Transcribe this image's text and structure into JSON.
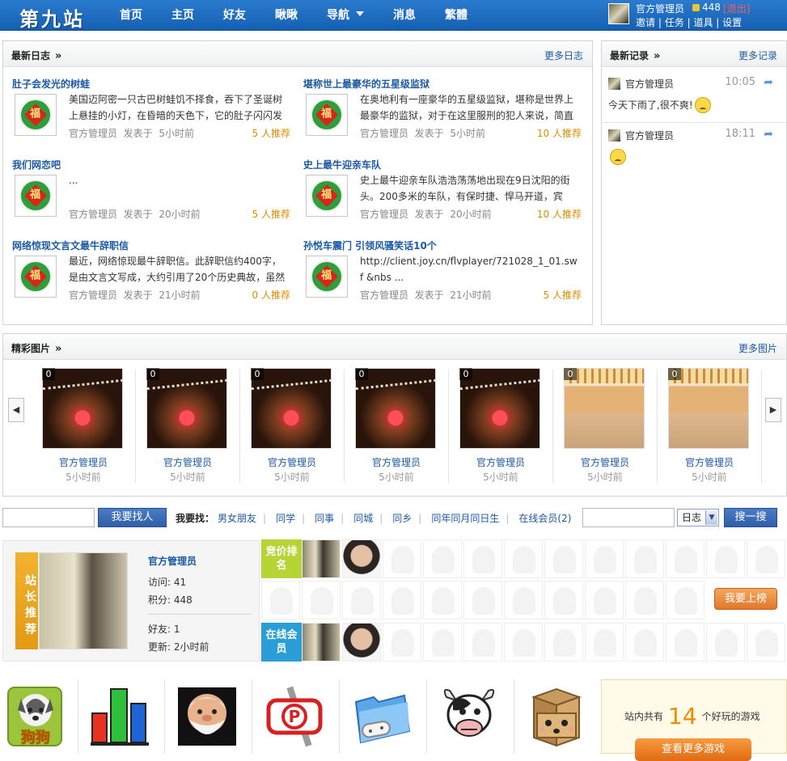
{
  "header": {
    "logo": "第九站",
    "nav": [
      {
        "label": "首页"
      },
      {
        "label": "主页"
      },
      {
        "label": "好友"
      },
      {
        "label": "瞅瞅"
      },
      {
        "label": "导航"
      },
      {
        "label": "消息"
      },
      {
        "label": "繁體"
      }
    ],
    "user": {
      "name": "官方管理员",
      "score": "448",
      "logout": "[退出]",
      "links": [
        "邀请",
        "任务",
        "道具",
        "设置"
      ],
      "link_sep": "|"
    }
  },
  "blogs": {
    "title": "最新日志",
    "more": "更多日志",
    "author_label": "官方管理员",
    "posted_label": "发表于",
    "items": [
      {
        "title": "肚子会发光的树蛙",
        "summary": "美国迈阿密一只古巴树蛙饥不择食，吞下了圣诞树上悬挂的小灯，在昏暗的天色下，它的肚子闪闪发",
        "time": "5小时前",
        "rec": "5 人推荐"
      },
      {
        "title": "堪称世上最豪华的五星级监狱",
        "summary": "在奥地利有一座豪华的五星级监狱，堪称是世界上最豪华的监狱，对于在这里服刑的犯人来说，简直",
        "time": "5小时前",
        "rec": "10 人推荐"
      },
      {
        "title": "我们网恋吧",
        "summary": "...",
        "time": "20小时前",
        "rec": "5 人推荐"
      },
      {
        "title": "史上最牛迎亲车队",
        "summary": "史上最牛迎亲车队浩浩荡荡地出现在9日沈阳的街头。200多米的车队，有保时捷、悍马开道，宾",
        "time": "20小时前",
        "rec": "10 人推荐"
      },
      {
        "title": "网络惊现文言文最牛辞职信",
        "summary": "最近，网络惊现最牛辞职信。此辞职信约400字，是由文言文写成，大约引用了20个历史典故，虽然",
        "time": "21小时前",
        "rec": "0 人推荐"
      },
      {
        "title": "孙悦车震门 引领风骚笑话10个",
        "summary": "http://client.joy.cn/flvplayer/721028_1_01.swf &nbs ...",
        "time": "21小时前",
        "rec": "5 人推荐"
      }
    ]
  },
  "records": {
    "title": "最新记录",
    "more": "更多记录",
    "items": [
      {
        "name": "官方管理员",
        "time": "10:05",
        "text": "今天下雨了,很不爽!"
      },
      {
        "name": "官方管理员",
        "time": "18:11",
        "text": ""
      }
    ]
  },
  "photos": {
    "title": "精彩图片",
    "more": "更多图片",
    "items": [
      {
        "count": "0",
        "name": "官方管理员",
        "time": "5小时前",
        "kind": "frog"
      },
      {
        "count": "0",
        "name": "官方管理员",
        "time": "5小时前",
        "kind": "frog"
      },
      {
        "count": "0",
        "name": "官方管理员",
        "time": "5小时前",
        "kind": "frog"
      },
      {
        "count": "0",
        "name": "官方管理员",
        "time": "5小时前",
        "kind": "frog"
      },
      {
        "count": "0",
        "name": "官方管理员",
        "time": "5小时前",
        "kind": "frog"
      },
      {
        "count": "0",
        "name": "官方管理员",
        "time": "5小时前",
        "kind": "hall"
      },
      {
        "count": "0",
        "name": "官方管理员",
        "time": "5小时前",
        "kind": "hall"
      }
    ]
  },
  "search": {
    "find_button": "我要找人",
    "quick_label": "我要找：",
    "quick_links": [
      "男女朋友",
      "同学",
      "同事",
      "同城",
      "同乡",
      "同年同月同日生",
      "在线会员(2)"
    ],
    "type_value": "日志",
    "search_button": "搜一搜"
  },
  "star": {
    "ribbon": "站长推荐",
    "name": "官方管理员",
    "visits": "访问: 41",
    "points": "积分: 448",
    "friends": "好友: 1",
    "updated": "更新: 2小时前"
  },
  "ranking": {
    "bid_label": "竞价排名",
    "online_label": "在线会员",
    "button": "我要上榜"
  },
  "games": {
    "prefix": "站内共有",
    "count": "14",
    "suffix": "个好玩的游戏",
    "more_button": "查看更多游戏",
    "icons": [
      "dog-icon",
      "bar-chart-icon",
      "old-man-icon",
      "parking-sign-icon",
      "game-folder-icon",
      "cow-icon",
      "box-face-icon"
    ],
    "colors": {
      "accent": "#f08a00",
      "link": "#1c5aa6",
      "header": "#1660b2"
    }
  }
}
